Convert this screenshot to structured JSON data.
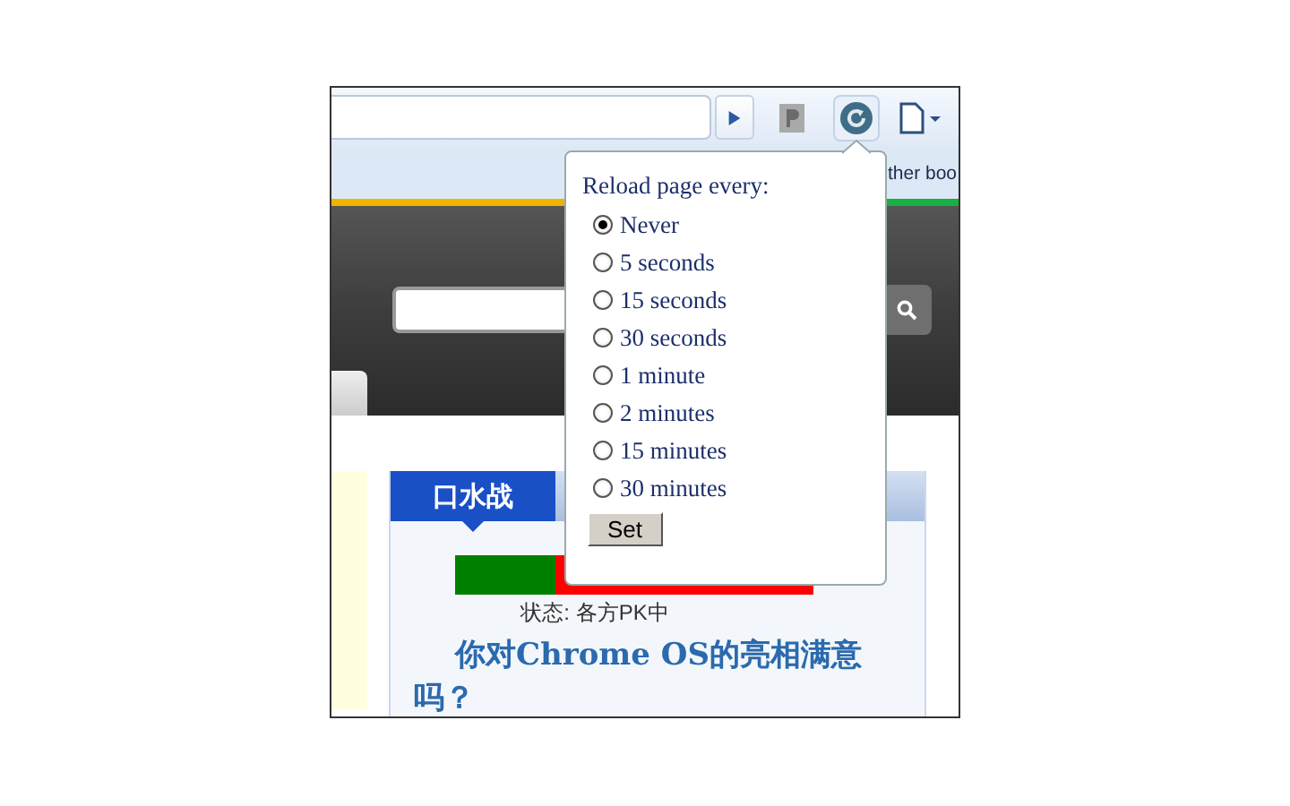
{
  "toolbar": {
    "bookmarks_text": "ther boo"
  },
  "poll": {
    "tab": "口水战",
    "level": 0.28,
    "status": "状态: 各方PK中",
    "question": "你对Chrome OS的亮相满意吗？"
  },
  "popup": {
    "title": "Reload page every:",
    "options": [
      {
        "label": "Never",
        "selected": true
      },
      {
        "label": "5 seconds",
        "selected": false
      },
      {
        "label": "15 seconds",
        "selected": false
      },
      {
        "label": "30 seconds",
        "selected": false
      },
      {
        "label": "1 minute",
        "selected": false
      },
      {
        "label": "2 minutes",
        "selected": false
      },
      {
        "label": "15 minutes",
        "selected": false
      },
      {
        "label": "30 minutes",
        "selected": false
      }
    ],
    "button": "Set"
  }
}
